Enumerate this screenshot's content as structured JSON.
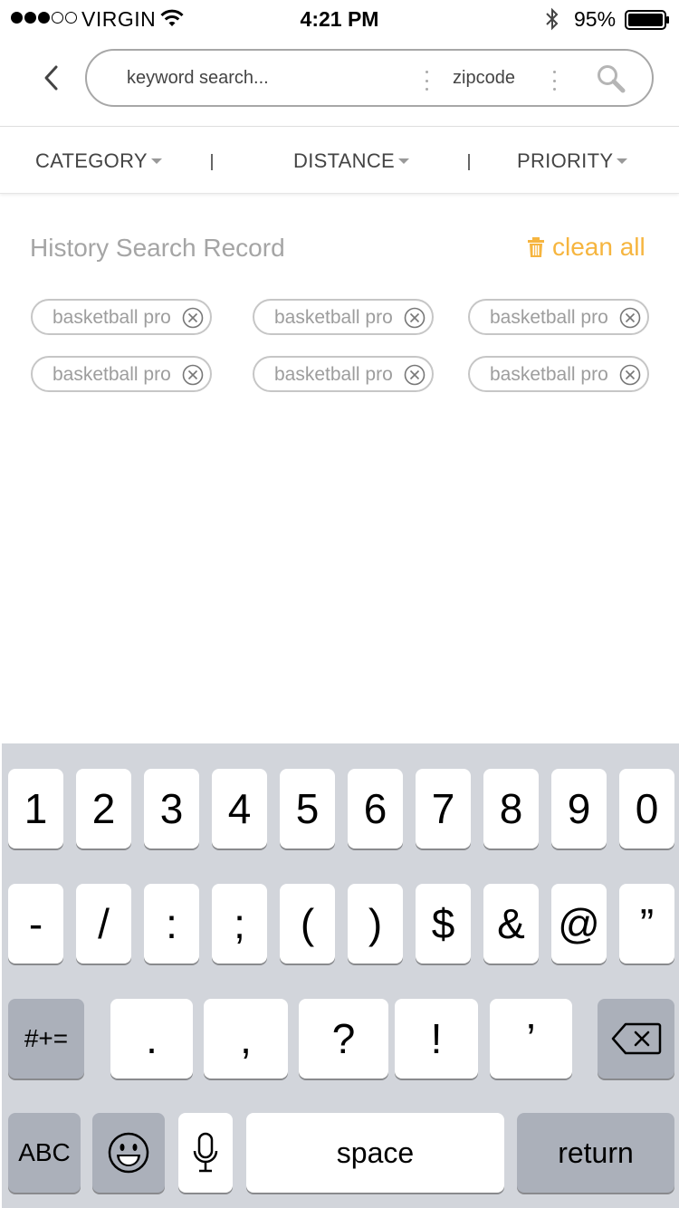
{
  "status_bar": {
    "carrier": "VIRGIN",
    "time": "4:21 PM",
    "battery": "95%",
    "signal_dots_filled": 3,
    "signal_dots_total": 5
  },
  "search": {
    "keyword_placeholder": "keyword search...",
    "zipcode_placeholder": "zipcode"
  },
  "filters": [
    {
      "label": "CATEGORY"
    },
    {
      "label": "DISTANCE"
    },
    {
      "label": "PRIORITY"
    }
  ],
  "history": {
    "title": "History Search Record",
    "clean_label": "clean all",
    "tags": [
      {
        "label": "basketball pro"
      },
      {
        "label": "basketball pro"
      },
      {
        "label": "basketball pro"
      },
      {
        "label": "basketball pro"
      },
      {
        "label": "basketball pro"
      },
      {
        "label": "basketball pro"
      }
    ]
  },
  "keyboard": {
    "row1": [
      "1",
      "2",
      "3",
      "4",
      "5",
      "6",
      "7",
      "8",
      "9",
      "0"
    ],
    "row2": [
      "-",
      "/",
      ":",
      ";",
      "(",
      ")",
      "$",
      "&",
      "@",
      "”"
    ],
    "row3": [
      ".",
      ",",
      "?",
      "!",
      "’"
    ],
    "symbols_toggle": "#+=",
    "abc_toggle": "ABC",
    "space": "space",
    "return": "return"
  },
  "colors": {
    "accent": "#f6b53f",
    "keyboard_bg": "#d2d5db",
    "dark_key": "#abb0ba"
  }
}
